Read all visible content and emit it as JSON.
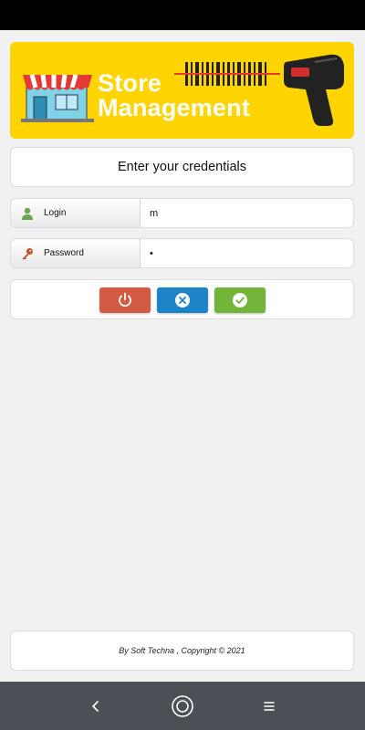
{
  "banner": {
    "title_line1": "Store",
    "title_line2": "Management"
  },
  "credentials": {
    "heading": "Enter your credentials"
  },
  "login": {
    "label": "Login",
    "value": "m",
    "icon": "user-icon"
  },
  "password": {
    "label": "Password",
    "value": "•",
    "icon": "key-icon"
  },
  "actions": [
    {
      "name": "power-button",
      "icon": "power-icon",
      "color": "#d35a43"
    },
    {
      "name": "cancel-button",
      "icon": "close-icon",
      "color": "#1e84c8"
    },
    {
      "name": "confirm-button",
      "icon": "check-icon",
      "color": "#72b53a"
    }
  ],
  "footer": {
    "text": "By Soft Techna , Copyright © 2021"
  },
  "navigation": {
    "back_icon": "back-icon",
    "home_icon": "home-icon",
    "menu_icon": "menu-icon"
  },
  "colors": {
    "banner": "#ffd400",
    "status_bar": "#000000",
    "nav_bar": "#4b5057",
    "background": "#f1f1f1"
  }
}
